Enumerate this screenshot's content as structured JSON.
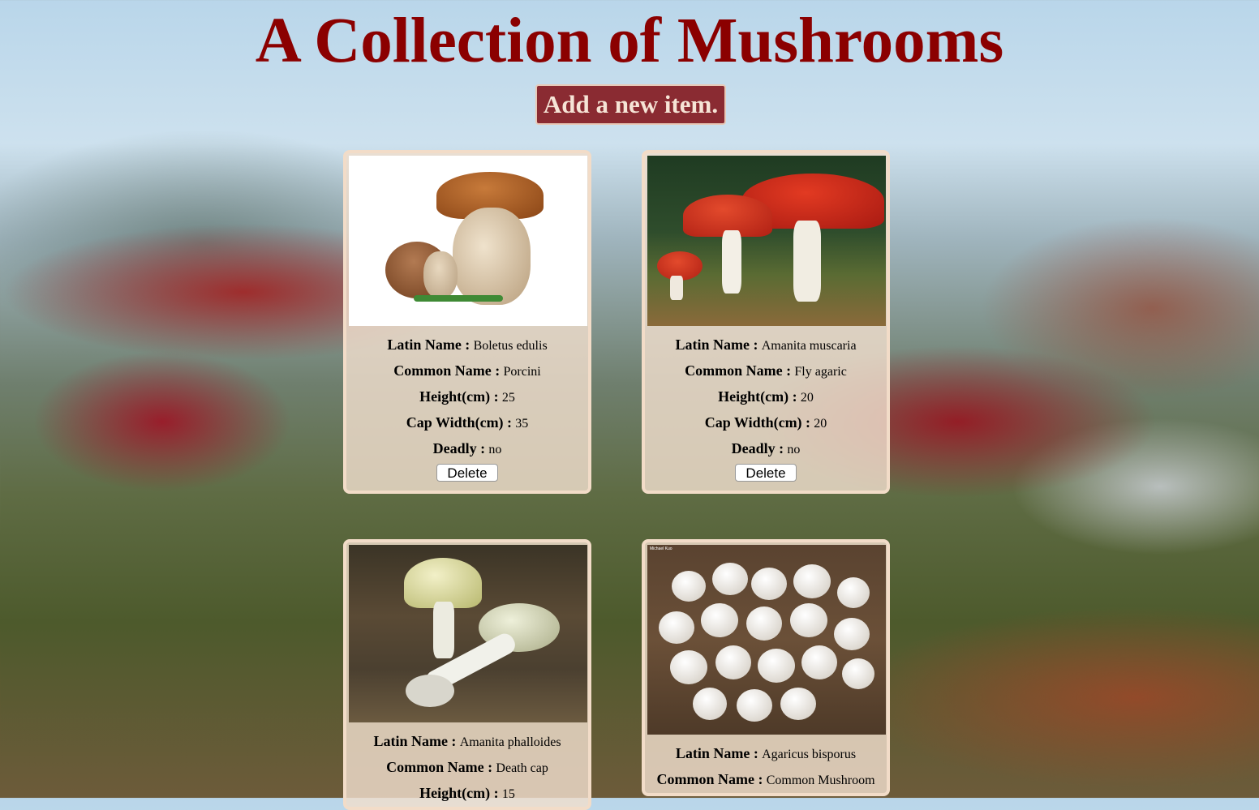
{
  "header": {
    "title": "A Collection of Mushrooms",
    "add_button_label": "Add a new item."
  },
  "labels": {
    "latin_name": "Latin Name :",
    "common_name": "Common Name :",
    "height": "Height(cm) :",
    "cap_width": "Cap Width(cm) :",
    "deadly": "Deadly :",
    "delete_button": "Delete"
  },
  "mushrooms": [
    {
      "latin_name": "Boletus edulis",
      "common_name": "Porcini",
      "height": "25",
      "cap_width": "35",
      "deadly": "no",
      "image": "porcini-photo"
    },
    {
      "latin_name": "Amanita muscaria",
      "common_name": "Fly agaric",
      "height": "20",
      "cap_width": "20",
      "deadly": "no",
      "image": "fly-agaric-photo"
    },
    {
      "latin_name": "Amanita phalloides",
      "common_name": "Death cap",
      "height": "15",
      "image": "death-cap-photo"
    },
    {
      "latin_name": "Agaricus bisporus",
      "common_name": "Common Mushroom",
      "image": "button-mushroom-photo",
      "photo_credit": "Michael Kuo"
    }
  ]
}
